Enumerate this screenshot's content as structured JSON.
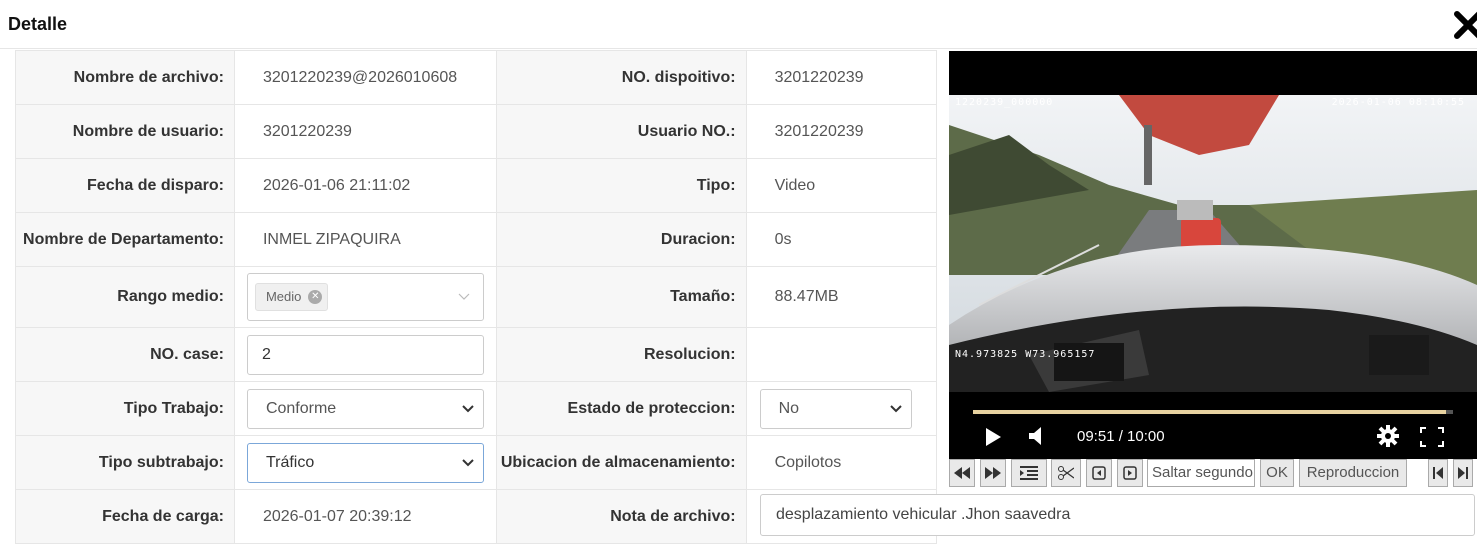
{
  "dialog": {
    "title": "Detalle",
    "close_icon": "close-icon"
  },
  "fields": {
    "nombre_archivo": {
      "label": "Nombre de archivo:",
      "value": "3201220239@2026010608"
    },
    "no_dispositivo": {
      "label": "NO. dispoitivo:",
      "value": "3201220239"
    },
    "nombre_usuario": {
      "label": "Nombre de usuario:",
      "value": "3201220239"
    },
    "usuario_no": {
      "label": "Usuario NO.:",
      "value": "3201220239"
    },
    "fecha_disparo": {
      "label": "Fecha de disparo:",
      "value": "2026-01-06 21:11:02"
    },
    "tipo": {
      "label": "Tipo:",
      "value": "Video"
    },
    "departamento": {
      "label": "Nombre de Departamento:",
      "value": "INMEL ZIPAQUIRA"
    },
    "duracion": {
      "label": "Duracion:",
      "value": "0s"
    },
    "rango_medio": {
      "label": "Rango medio:",
      "tag": "Medio"
    },
    "tamano": {
      "label": "Tamaño:",
      "value": "88.47MB"
    },
    "no_case": {
      "label": "NO. case:",
      "value": "2"
    },
    "resolucion": {
      "label": "Resolucion:",
      "value": ""
    },
    "tipo_trabajo": {
      "label": "Tipo Trabajo:",
      "selected": "Conforme"
    },
    "estado_proteccion": {
      "label": "Estado de proteccion:",
      "selected": "No"
    },
    "tipo_subtrabajo": {
      "label": "Tipo subtrabajo:",
      "selected": "Tráfico"
    },
    "ubicacion": {
      "label": "Ubicacion de almacenamiento:",
      "value": "Copilotos"
    },
    "fecha_carga": {
      "label": "Fecha de carga:",
      "value": "2026-01-07 20:39:12"
    },
    "nota_archivo": {
      "label": "Nota de archivo:",
      "value": "desplazamiento vehicular .Jhon saavedra"
    }
  },
  "player": {
    "osd_left": "1220239_000000",
    "osd_datetime": "2026-01-06 08:10:55",
    "osd_gps": "N4.973825 W73.965157",
    "time_display": "09:51 / 10:00",
    "progress": 0.985
  },
  "toolbar": {
    "seek_placeholder": "Saltar segundo",
    "ok_label": "OK",
    "playback_label": "Reproduccion"
  }
}
